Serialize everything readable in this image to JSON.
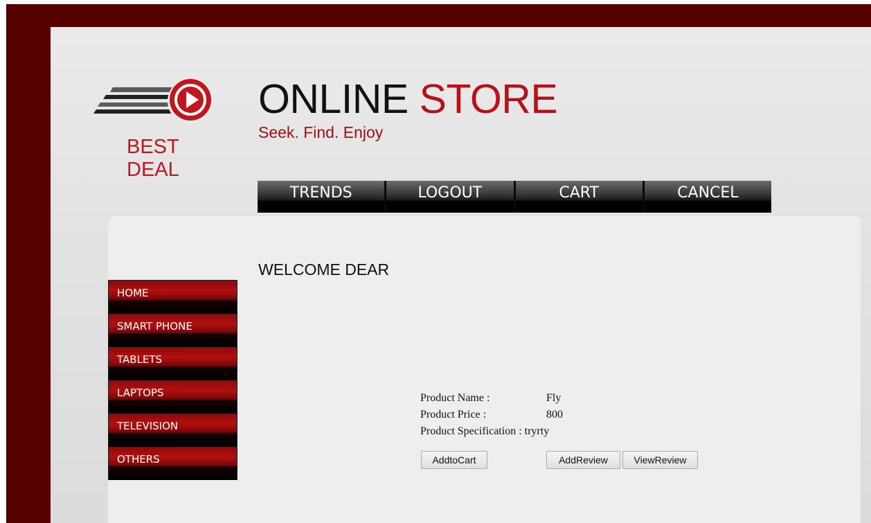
{
  "brand": {
    "logo_icon": "play-arrow-icon",
    "logo_line1": "BEST",
    "logo_line2": "DEAL",
    "title_part1": "ONLINE",
    "title_part2": "STORE",
    "tagline": "Seek. Find. Enjoy"
  },
  "topnav": {
    "items": [
      {
        "label": "TRENDS"
      },
      {
        "label": "LOGOUT"
      },
      {
        "label": "CART"
      },
      {
        "label": "CANCEL"
      }
    ]
  },
  "main": {
    "welcome": "WELCOME DEAR"
  },
  "sidenav": {
    "items": [
      {
        "label": "HOME"
      },
      {
        "label": "SMART PHONE"
      },
      {
        "label": "TABLETS"
      },
      {
        "label": "LAPTOPS"
      },
      {
        "label": "TELEVISION"
      },
      {
        "label": "OTHERS"
      }
    ]
  },
  "product": {
    "name_label": "Product Name :",
    "name_value": "Fly",
    "price_label": "Product Price :",
    "price_value": "800",
    "spec_label": "Product Specification :",
    "spec_value": "tryrty",
    "buttons": {
      "add_to_cart": "AddtoCart",
      "add_review": "AddReview",
      "view_review": "ViewReview"
    }
  },
  "colors": {
    "frame": "#560000",
    "accent_red": "#b5121b",
    "panel": "#e4e4e4"
  }
}
